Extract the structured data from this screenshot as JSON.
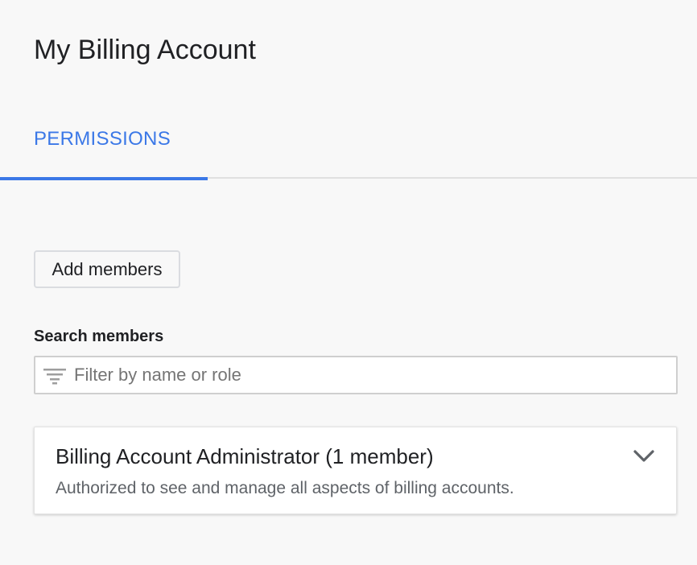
{
  "page": {
    "title": "My Billing Account"
  },
  "tabs": [
    {
      "label": "PERMISSIONS",
      "active": true
    }
  ],
  "actions": {
    "add_members_label": "Add members"
  },
  "search": {
    "label": "Search members",
    "placeholder": "Filter by name or role",
    "value": "",
    "icon": "filter-icon"
  },
  "roles": [
    {
      "title": "Billing Account Administrator (1 member)",
      "description": "Authorized to see and manage all aspects of billing accounts.",
      "expand_icon": "chevron-down-icon"
    }
  ],
  "colors": {
    "accent": "#3b78e7",
    "background": "#f8f8f8",
    "text_primary": "#202124",
    "text_secondary": "#5f6368"
  }
}
